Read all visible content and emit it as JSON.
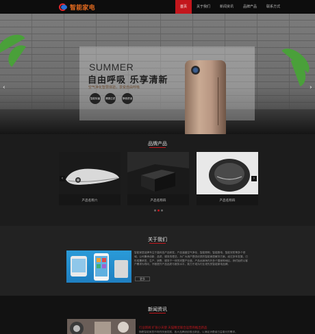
{
  "header": {
    "logo_text": "智能家电",
    "nav": [
      "首页",
      "关于我们",
      "新闻资讯",
      "品牌产品",
      "联系方式"
    ],
    "active_index": 0
  },
  "banner": {
    "title_en": "SUMMER",
    "title_cn": "自由呼吸 乐享清新",
    "subtitle": "空气净化智慧体验，享受自由呼吸",
    "features": [
      "智能除菌",
      "健康过滤",
      "静音舒适"
    ]
  },
  "products": {
    "title": "品牌产品",
    "items": [
      {
        "label": "产品名称六"
      },
      {
        "label": "产品名称四"
      },
      {
        "label": "产品名称四"
      }
    ]
  },
  "about": {
    "title": "关于我们",
    "text": "智能家居品牌专注于高科技产品研发，产品涵盖空气净化、智能照明、智能厨电、智能安防等多个领域。公司秉承创新、品质、服务的理念，为广大用户提供优质的智能家居解决方案。经过多年发展，已形成集研发、生产、销售、服务于一体的完整产业链，产品远销海内外多个国家和地区。我们始终以客户需求为导向，不断提升产品品质与服务水平，致力于成为行业领先的智能家电品牌。",
    "more": "更多"
  },
  "news": {
    "title": "新闻资讯",
    "headline": "行业新闻  扩张小天使 天猫精灵联合运营商推出新品",
    "summary": "随着智能家居市场的快速发展，各大品牌纷纷推出新品，以满足消费者日益增长的需求。"
  },
  "colors": {
    "accent": "#c3161c",
    "logo": "#e26a1f",
    "background": "#111111"
  }
}
